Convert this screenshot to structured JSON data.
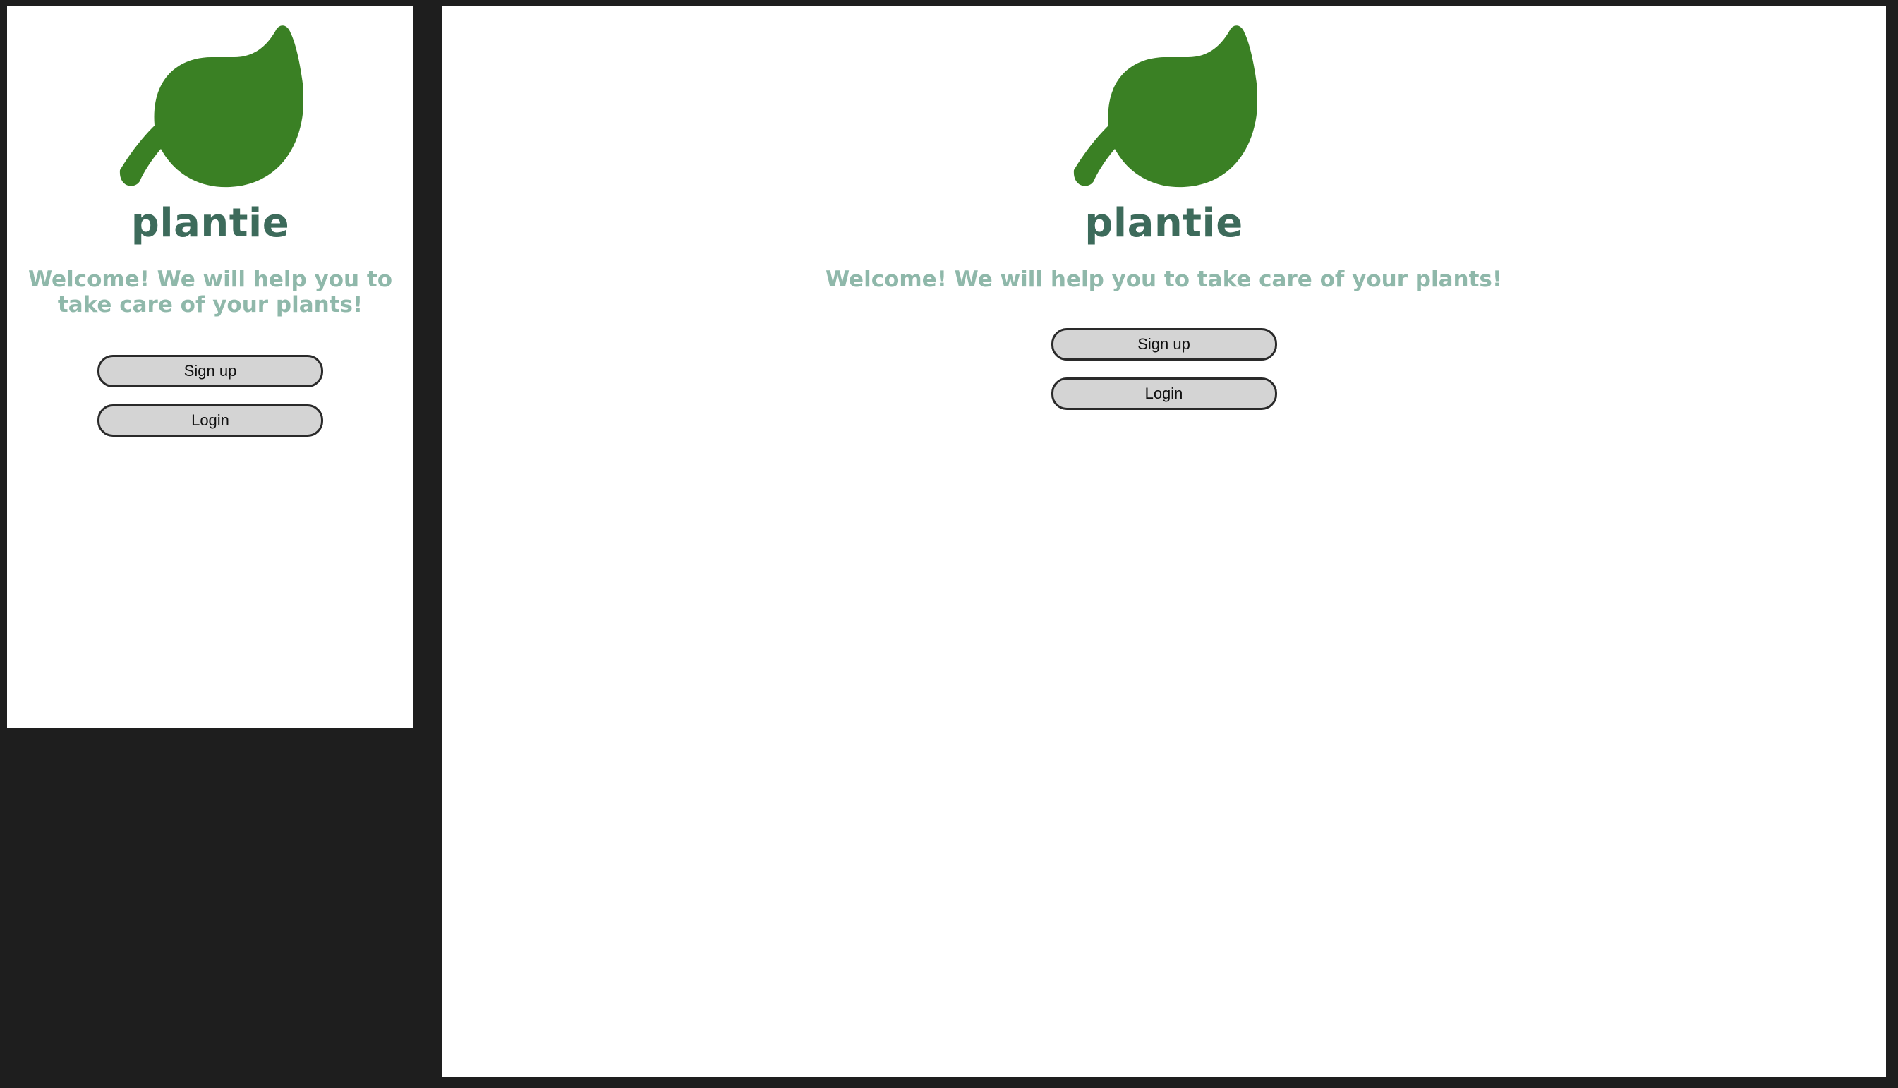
{
  "app": {
    "brand": "plantie",
    "welcome": "Welcome! We will help you to take care of your plants!",
    "signup_label": "Sign up",
    "login_label": "Login"
  },
  "icons": {
    "logo": "leaf-icon"
  },
  "colors": {
    "leaf": "#3a8024",
    "brand_text": "#3d6b5b",
    "welcome_text": "#8fb8aa",
    "button_bg": "#d4d4d4",
    "button_border": "#2a2a2a",
    "backdrop": "#1e1e1e"
  }
}
